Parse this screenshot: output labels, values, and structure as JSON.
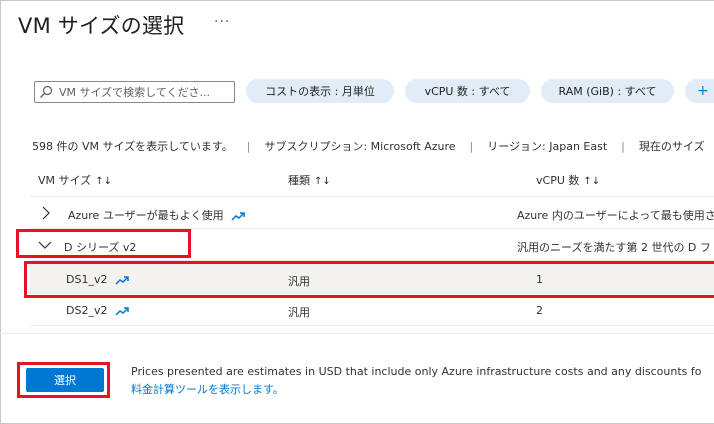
{
  "title": "VM サイズの選択",
  "more_label": "···",
  "search": {
    "placeholder": "VM サイズで検索してくださ..."
  },
  "filters": {
    "cost": "コストの表示 : 月単位",
    "vcpu": "vCPU 数 : すべて",
    "ram": "RAM (GiB) : すべて",
    "add": "+"
  },
  "info": {
    "count": "598 件の VM サイズを表示しています。",
    "subscription": "サブスクリプション: Microsoft Azure",
    "region": "リージョン: Japan East",
    "current": "現在のサイズ"
  },
  "columns": {
    "vm_size": "VM サイズ",
    "type": "種類",
    "vcpu": "vCPU 数",
    "sort_glyph": "↑↓"
  },
  "groups": [
    {
      "name": "Azure ユーザーが最もよく使用",
      "description": "Azure 内のユーザーによって最も使用さ"
    },
    {
      "name": "D シリーズ v2",
      "description": "汎用のニーズを満たす第 2 世代の D フ"
    }
  ],
  "rows": [
    {
      "name": "DS1_v2",
      "type": "汎用",
      "vcpu": "1"
    },
    {
      "name": "DS2_v2",
      "type": "汎用",
      "vcpu": "2"
    }
  ],
  "footer": {
    "select_button": "選択",
    "notice": "Prices presented are estimates in USD that include only Azure infrastructure costs and any discounts fo",
    "link": "料金計算ツールを表示します。"
  },
  "colors": {
    "accent": "#0078d4",
    "highlight": "#e81123",
    "pill": "#e1ecf7"
  }
}
